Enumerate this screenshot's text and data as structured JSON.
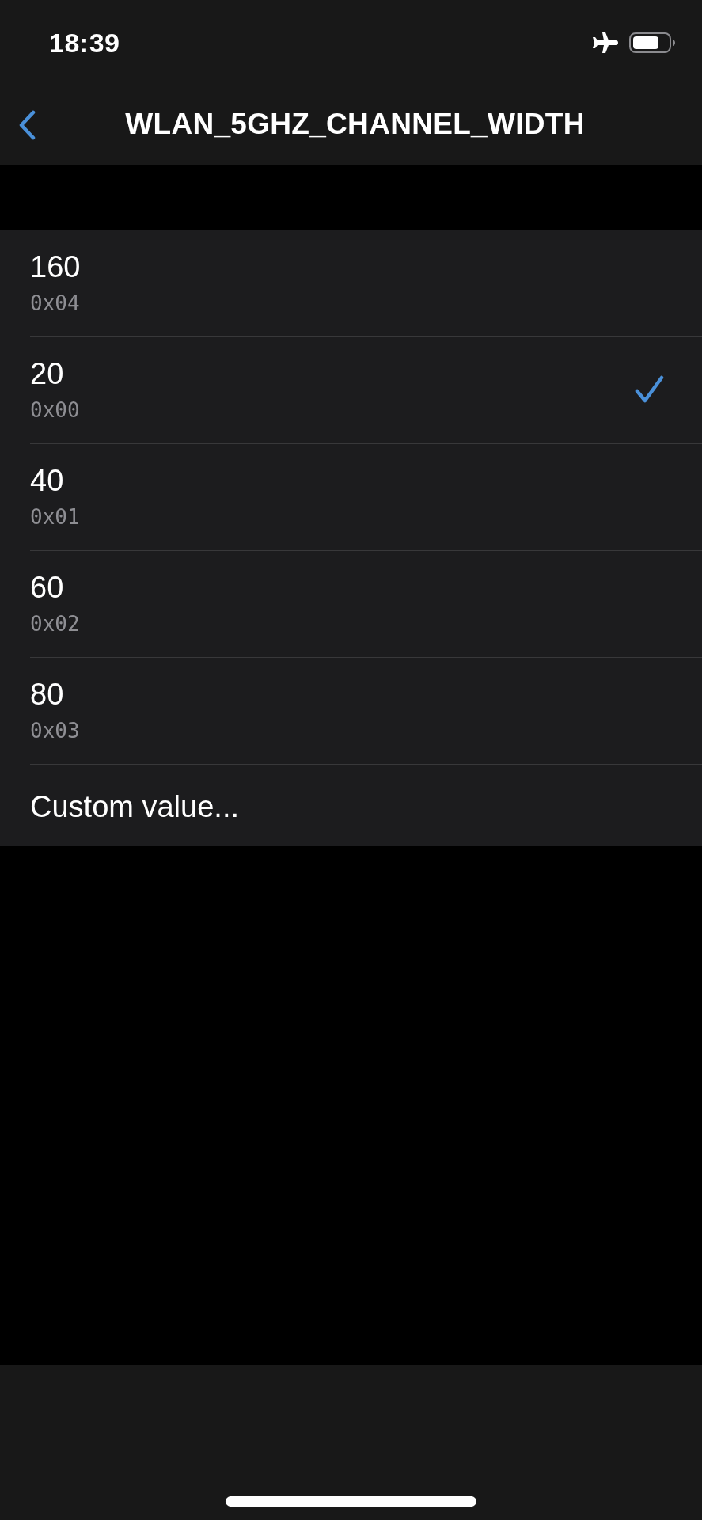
{
  "status_bar": {
    "time": "18:39"
  },
  "nav_bar": {
    "title": "WLAN_5GHZ_CHANNEL_WIDTH"
  },
  "options": [
    {
      "label": "160",
      "value": "0x04",
      "selected": false
    },
    {
      "label": "20",
      "value": "0x00",
      "selected": true
    },
    {
      "label": "40",
      "value": "0x01",
      "selected": false
    },
    {
      "label": "60",
      "value": "0x02",
      "selected": false
    },
    {
      "label": "80",
      "value": "0x03",
      "selected": false
    }
  ],
  "custom_option": {
    "label": "Custom value..."
  }
}
